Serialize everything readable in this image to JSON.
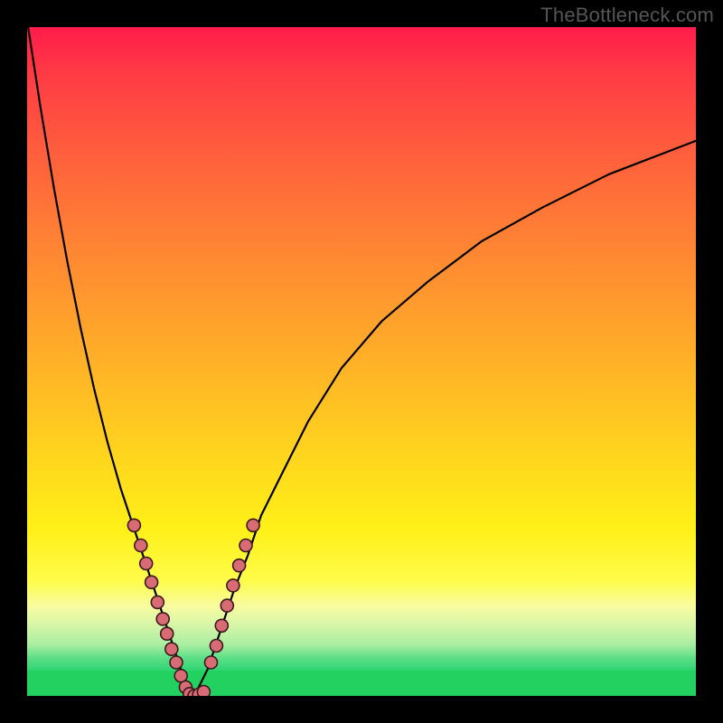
{
  "watermark": "TheBottleneck.com",
  "colors": {
    "frame": "#000000",
    "curve": "#000000",
    "dot_fill": "#d96b74",
    "dot_stroke": "#3a1a1d",
    "bottom_strip": "#23d160"
  },
  "chart_data": {
    "type": "line",
    "title": "",
    "xlabel": "",
    "ylabel": "",
    "xlim": [
      0,
      100
    ],
    "ylim": [
      0,
      100
    ],
    "x_min_at": 25,
    "curve_left": {
      "x": [
        0,
        2,
        4,
        6,
        8,
        10,
        12,
        14,
        16,
        18,
        20,
        21,
        22,
        23,
        24,
        25
      ],
      "y": [
        101,
        88,
        76,
        65,
        55,
        46,
        38,
        31,
        25,
        19,
        13,
        10,
        7,
        4,
        1,
        0
      ]
    },
    "curve_right": {
      "x": [
        25,
        26,
        27,
        28,
        29,
        30,
        31,
        33,
        35,
        38,
        42,
        47,
        53,
        60,
        68,
        77,
        87,
        100
      ],
      "y": [
        0,
        2,
        4,
        7,
        10,
        13,
        16,
        21,
        27,
        33,
        41,
        49,
        56,
        62,
        68,
        73,
        78,
        83
      ]
    },
    "series": [
      {
        "name": "markers-left",
        "x": [
          16.0,
          17.0,
          17.8,
          18.6,
          19.5,
          20.3,
          20.9,
          21.6,
          22.3,
          23.0,
          23.7
        ],
        "y": [
          25.5,
          22.5,
          19.8,
          17.0,
          14.0,
          11.5,
          9.3,
          7.0,
          5.0,
          3.0,
          1.3
        ]
      },
      {
        "name": "markers-bottom",
        "x": [
          24.3,
          25.0,
          25.7,
          26.4
        ],
        "y": [
          0.3,
          0.0,
          0.2,
          0.6
        ]
      },
      {
        "name": "markers-right",
        "x": [
          27.5,
          28.3,
          29.1,
          29.9,
          30.8,
          31.7,
          32.7,
          33.8
        ],
        "y": [
          5.0,
          7.5,
          10.5,
          13.5,
          16.5,
          19.5,
          22.5,
          25.5
        ]
      }
    ],
    "dot_radius_px": 7
  }
}
